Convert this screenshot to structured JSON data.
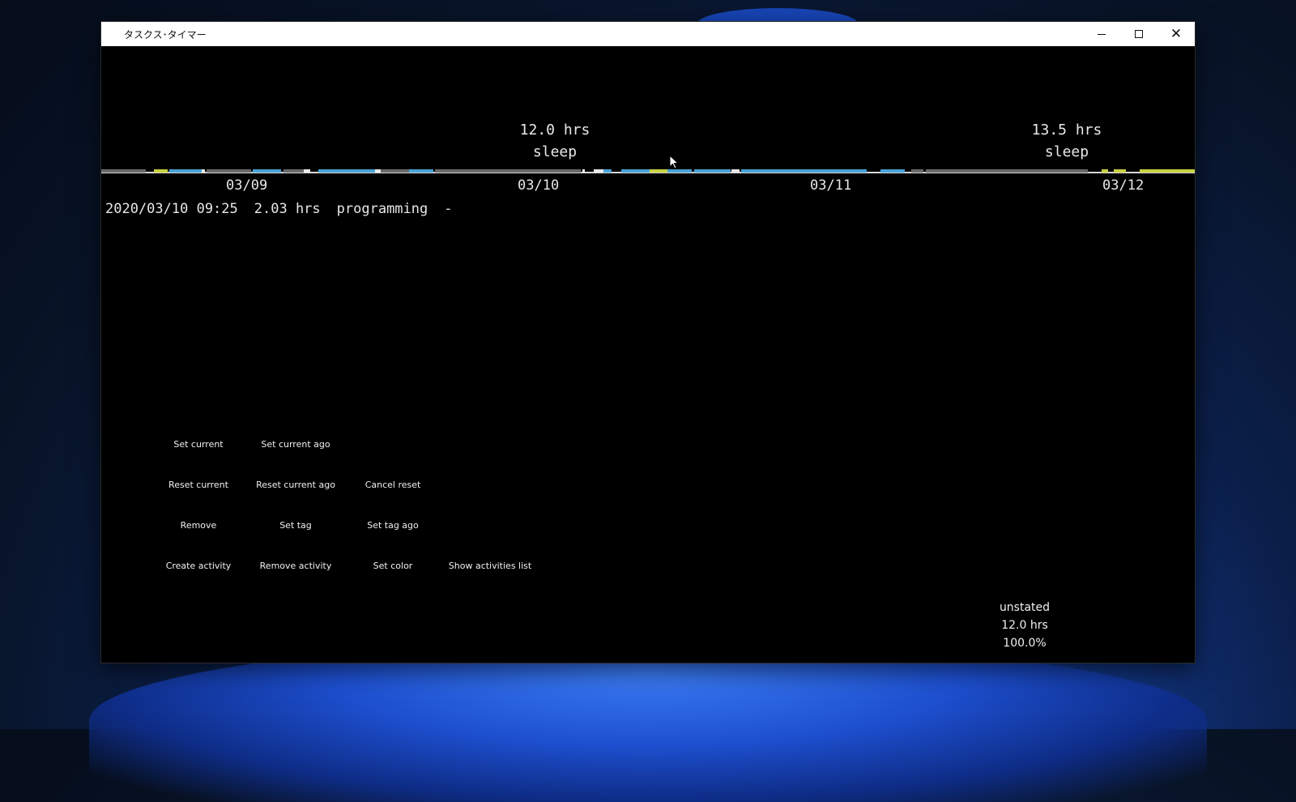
{
  "window": {
    "title": "タスクス･タイマー",
    "controls": {
      "minimize": "minimize",
      "maximize": "maximize",
      "close": "close"
    }
  },
  "summaries": [
    {
      "hours": "12.0 hrs",
      "activity": "sleep"
    },
    {
      "hours": "13.5 hrs",
      "activity": "sleep"
    }
  ],
  "timeline": {
    "dates": [
      "03/09",
      "03/10",
      "03/11",
      "03/12"
    ],
    "colors": {
      "programming": "#4aa3d8",
      "other": "#c8d040",
      "sleep": "#6a6a6a",
      "misc": "#e8e8e8"
    }
  },
  "current": {
    "datetime": "2020/03/10 09:25",
    "duration": "2.03 hrs",
    "activity": "programming",
    "tag": "-"
  },
  "buttons": {
    "set_current": "Set current",
    "set_current_ago": "Set current ago",
    "reset_current": "Reset current",
    "reset_current_ago": "Reset current ago",
    "cancel_reset": "Cancel reset",
    "remove": "Remove",
    "set_tag": "Set tag",
    "set_tag_ago": "Set tag ago",
    "create_activity": "Create activity",
    "remove_activity": "Remove activity",
    "set_color": "Set color",
    "show_activities_list": "Show activities list"
  },
  "stats": {
    "activity": "unstated",
    "hours": "12.0 hrs",
    "percent": "100.0%"
  }
}
